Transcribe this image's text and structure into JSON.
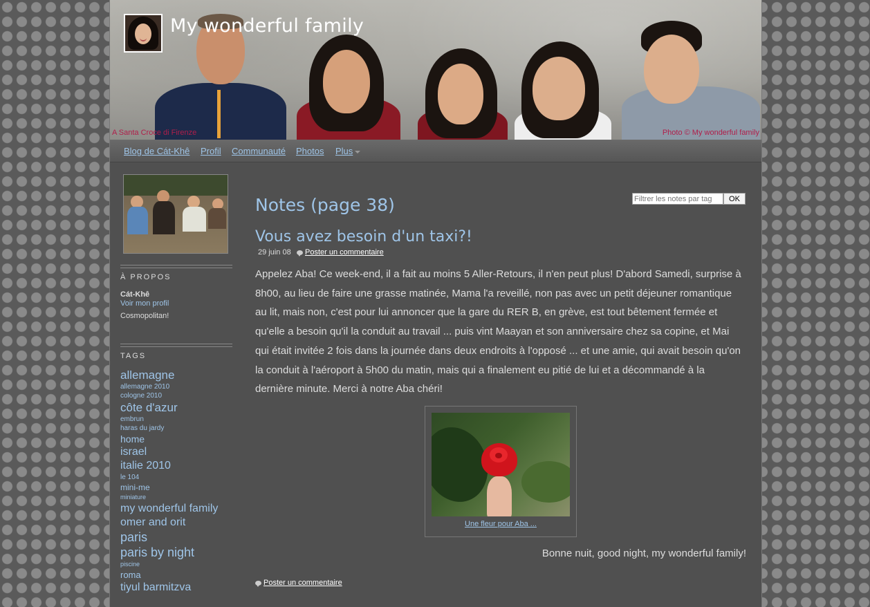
{
  "header": {
    "site_title": "My wonderful family",
    "caption_left": "A Santa Croce di Firenze",
    "caption_right": "Photo © My wonderful family"
  },
  "nav": {
    "items": [
      "Blog de Cát-Khê",
      "Profil",
      "Communauté",
      "Photos",
      "Plus"
    ]
  },
  "sidebar": {
    "about_heading": "À PROPOS",
    "about_name": "Cát-Khê",
    "about_link": "Voir mon profil",
    "about_desc": "Cosmopolitan!",
    "tags_heading": "TAGS",
    "tags": [
      {
        "label": "allemagne",
        "size": 17
      },
      {
        "label": "allemagne 2010",
        "size": 10
      },
      {
        "label": "cologne 2010",
        "size": 10
      },
      {
        "label": "côte d'azur",
        "size": 17
      },
      {
        "label": "embrun",
        "size": 10
      },
      {
        "label": "haras du jardy",
        "size": 10
      },
      {
        "label": "home",
        "size": 14
      },
      {
        "label": "israel",
        "size": 16
      },
      {
        "label": "italie 2010",
        "size": 16
      },
      {
        "label": "le 104",
        "size": 10
      },
      {
        "label": "mini-me",
        "size": 12
      },
      {
        "label": "miniature",
        "size": 9
      },
      {
        "label": "my wonderful family",
        "size": 16
      },
      {
        "label": "omer and orit",
        "size": 16
      },
      {
        "label": "paris",
        "size": 18
      },
      {
        "label": "paris by night",
        "size": 18
      },
      {
        "label": "piscine",
        "size": 9
      },
      {
        "label": "roma",
        "size": 13
      },
      {
        "label": "tiyul barmitzva",
        "size": 16
      }
    ]
  },
  "main": {
    "filter_placeholder": "Filtrer les notes par tag",
    "filter_button": "OK",
    "page_title": "Notes (page 38)",
    "post": {
      "title": "Vous avez besoin d'un taxi?!",
      "date": "29 juin 08",
      "comment_link": "Poster un commentaire",
      "body": "Appelez Aba! Ce week-end, il a fait au moins 5 Aller-Retours, il n'en peut plus! D'abord Samedi, surprise à 8h00, au lieu de faire une grasse matinée, Mama l'a reveillé, non pas avec un petit déjeuner romantique au lit, mais non, c'est pour lui annoncer que la gare du RER B, en grève, est tout bêtement fermée et qu'elle a besoin qu'il la conduit au travail ... puis vint Maayan et son anniversaire chez sa copine, et Mai qui était invitée 2 fois dans la journée dans deux endroits à l'opposé ... et une amie, qui avait besoin qu'on la conduit à l'aéroport à 5h00 du matin, mais qui a finalement eu pitié de lui et a décommandé à la dernière minute. Merci à notre Aba chéri!",
      "photo_caption": "Une fleur pour Aba ...",
      "sign_off": "Bonne nuit, good night, my wonderful family!",
      "footer_comment_link": "Poster un commentaire"
    }
  }
}
